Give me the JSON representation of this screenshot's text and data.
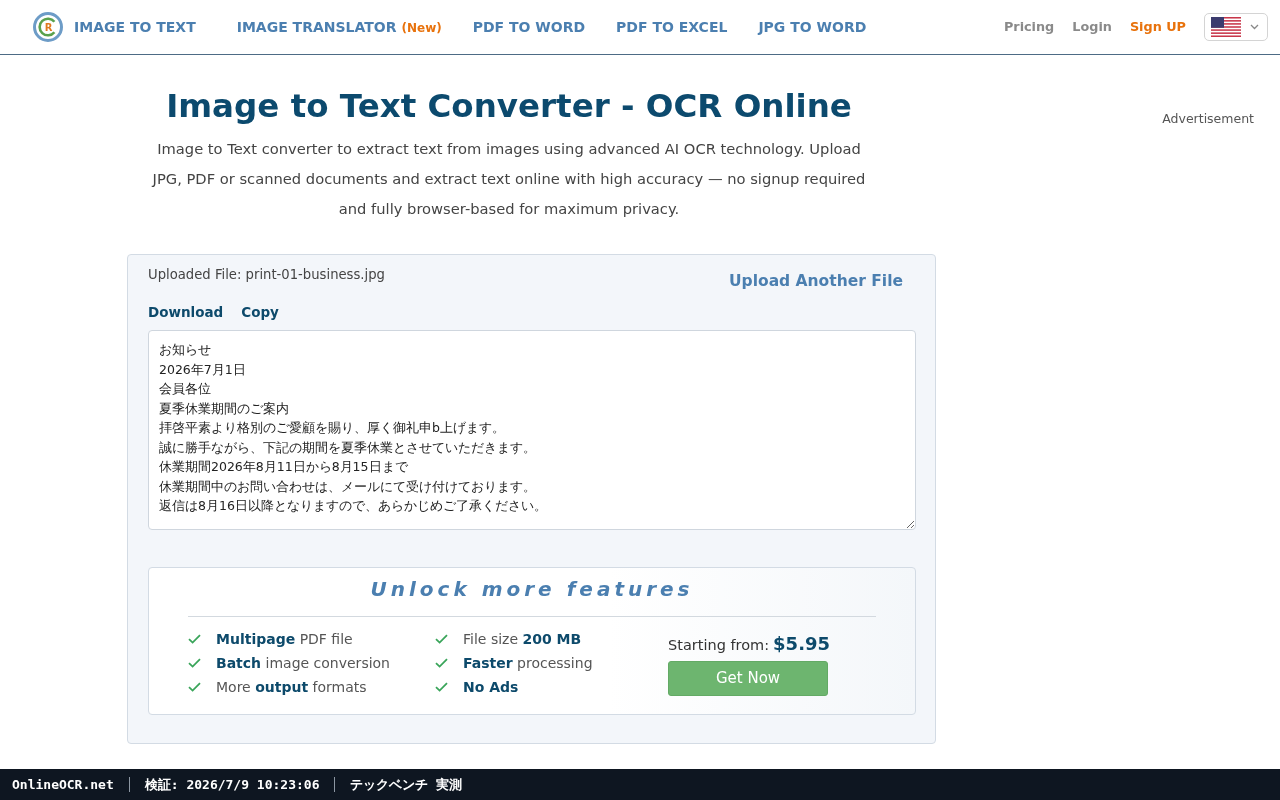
{
  "header": {
    "logo": {
      "mark": "R",
      "label": "IMAGE TO TEXT"
    },
    "nav": [
      {
        "label": "IMAGE TRANSLATOR",
        "badge": "(New)"
      },
      {
        "label": "PDF TO WORD"
      },
      {
        "label": "PDF TO EXCEL"
      },
      {
        "label": "JPG TO WORD"
      }
    ],
    "account_links": [
      {
        "label": "Pricing",
        "kind": "link"
      },
      {
        "label": "Login",
        "kind": "link"
      },
      {
        "label": "Sign UP",
        "kind": "signup"
      }
    ]
  },
  "intro": {
    "title": "Image to Text Converter - OCR Online",
    "description": "Image to Text converter to extract text from images using advanced AI OCR technology. Upload JPG, PDF or scanned documents and extract text online with high accuracy — no signup required and fully browser-based for maximum privacy."
  },
  "sidebar": {
    "advertisement_label": "Advertisement"
  },
  "result": {
    "file_label": "Uploaded File: print-01-business.jpg",
    "upload_another": "Upload Another File",
    "actions": [
      "Download",
      "Copy"
    ],
    "text_lines": [
      "お知らせ",
      "2026年7月1日",
      "会員各位",
      "夏季休業期間のご案内",
      "拝啓平素より格別のご愛顧を賜り、厚く御礼申b上げます。",
      "誠に勝手ながら、下記の期間を夏季休業とさせていただきます。",
      "休業期間2026年8月11日から8月15日まで",
      "休業期間中のお問い合わせは、メールにて受け付けております。",
      "返信は8月16日以降となりますので、あらかじめご了承ください。"
    ]
  },
  "upgrade": {
    "title": "Unlock more features",
    "features": [
      {
        "text": "**Multipage** PDF file",
        "emphasis": false
      },
      {
        "text": "**Batch** image conversion",
        "emphasis": false
      },
      {
        "text": "More **output** formats",
        "emphasis": false
      },
      {
        "text": "File size **200 MB**",
        "emphasis": false
      },
      {
        "text": "**Faster** processing",
        "emphasis": false
      },
      {
        "text": "No Ads",
        "emphasis": true
      }
    ],
    "price_label": "Starting from:",
    "price": "$5.95",
    "button": "Get Now"
  },
  "status_bar": {
    "items": [
      "OnlineOCR.net",
      "検証: 2026/7/9 10:23:06",
      "テックベンチ 実測"
    ]
  }
}
